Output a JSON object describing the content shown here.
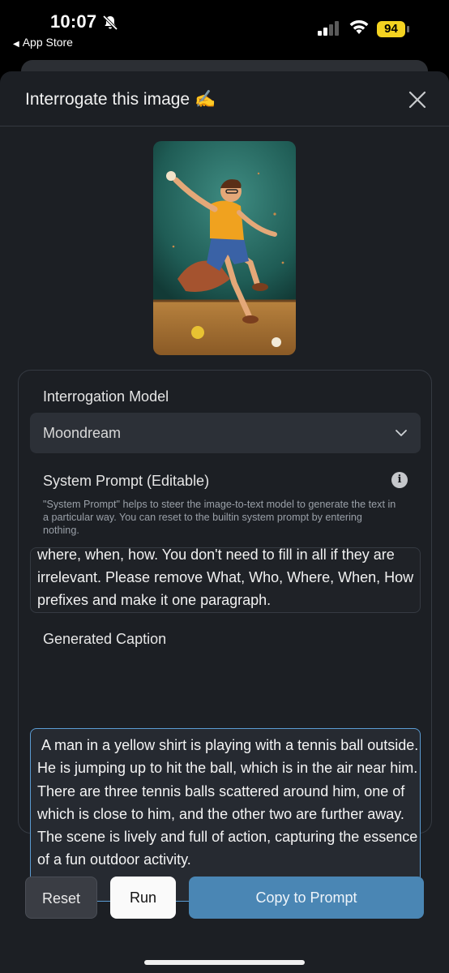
{
  "status_bar": {
    "time": "10:07",
    "back_app": "App Store",
    "battery": "94",
    "battery_color": "#f4d321"
  },
  "sheet": {
    "title": "Interrogate this image ✍️",
    "close_icon": "close-icon"
  },
  "preview": {
    "alt": "Generated image of a man in a yellow shirt jumping with tennis balls"
  },
  "model": {
    "label": "Interrogation Model",
    "selected": "Moondream"
  },
  "system_prompt": {
    "label": "System Prompt (Editable)",
    "help": "\"System Prompt\" helps to steer the image-to-text model to generate the text in a particular way. You can reset to the builtin system prompt by entering nothing.",
    "value": "where, when, how. You don't need to fill in all if they are irrelevant. Please remove What, Who, Where, When, How prefixes and make it one paragraph."
  },
  "caption": {
    "label": "Generated Caption",
    "value": " A man in a yellow shirt is playing with a tennis ball outside. He is jumping up to hit the ball, which is in the air near him. There are three tennis balls scattered around him, one of which is close to him, and the other two are further away. The scene is lively and full of action, capturing the essence of a fun outdoor activity."
  },
  "buttons": {
    "reset": "Reset",
    "run": "Run",
    "copy": "Copy to Prompt"
  },
  "colors": {
    "accent": "#4a86b4",
    "focus_border": "#5b9cd3",
    "sheet_bg": "#1c1f24"
  }
}
